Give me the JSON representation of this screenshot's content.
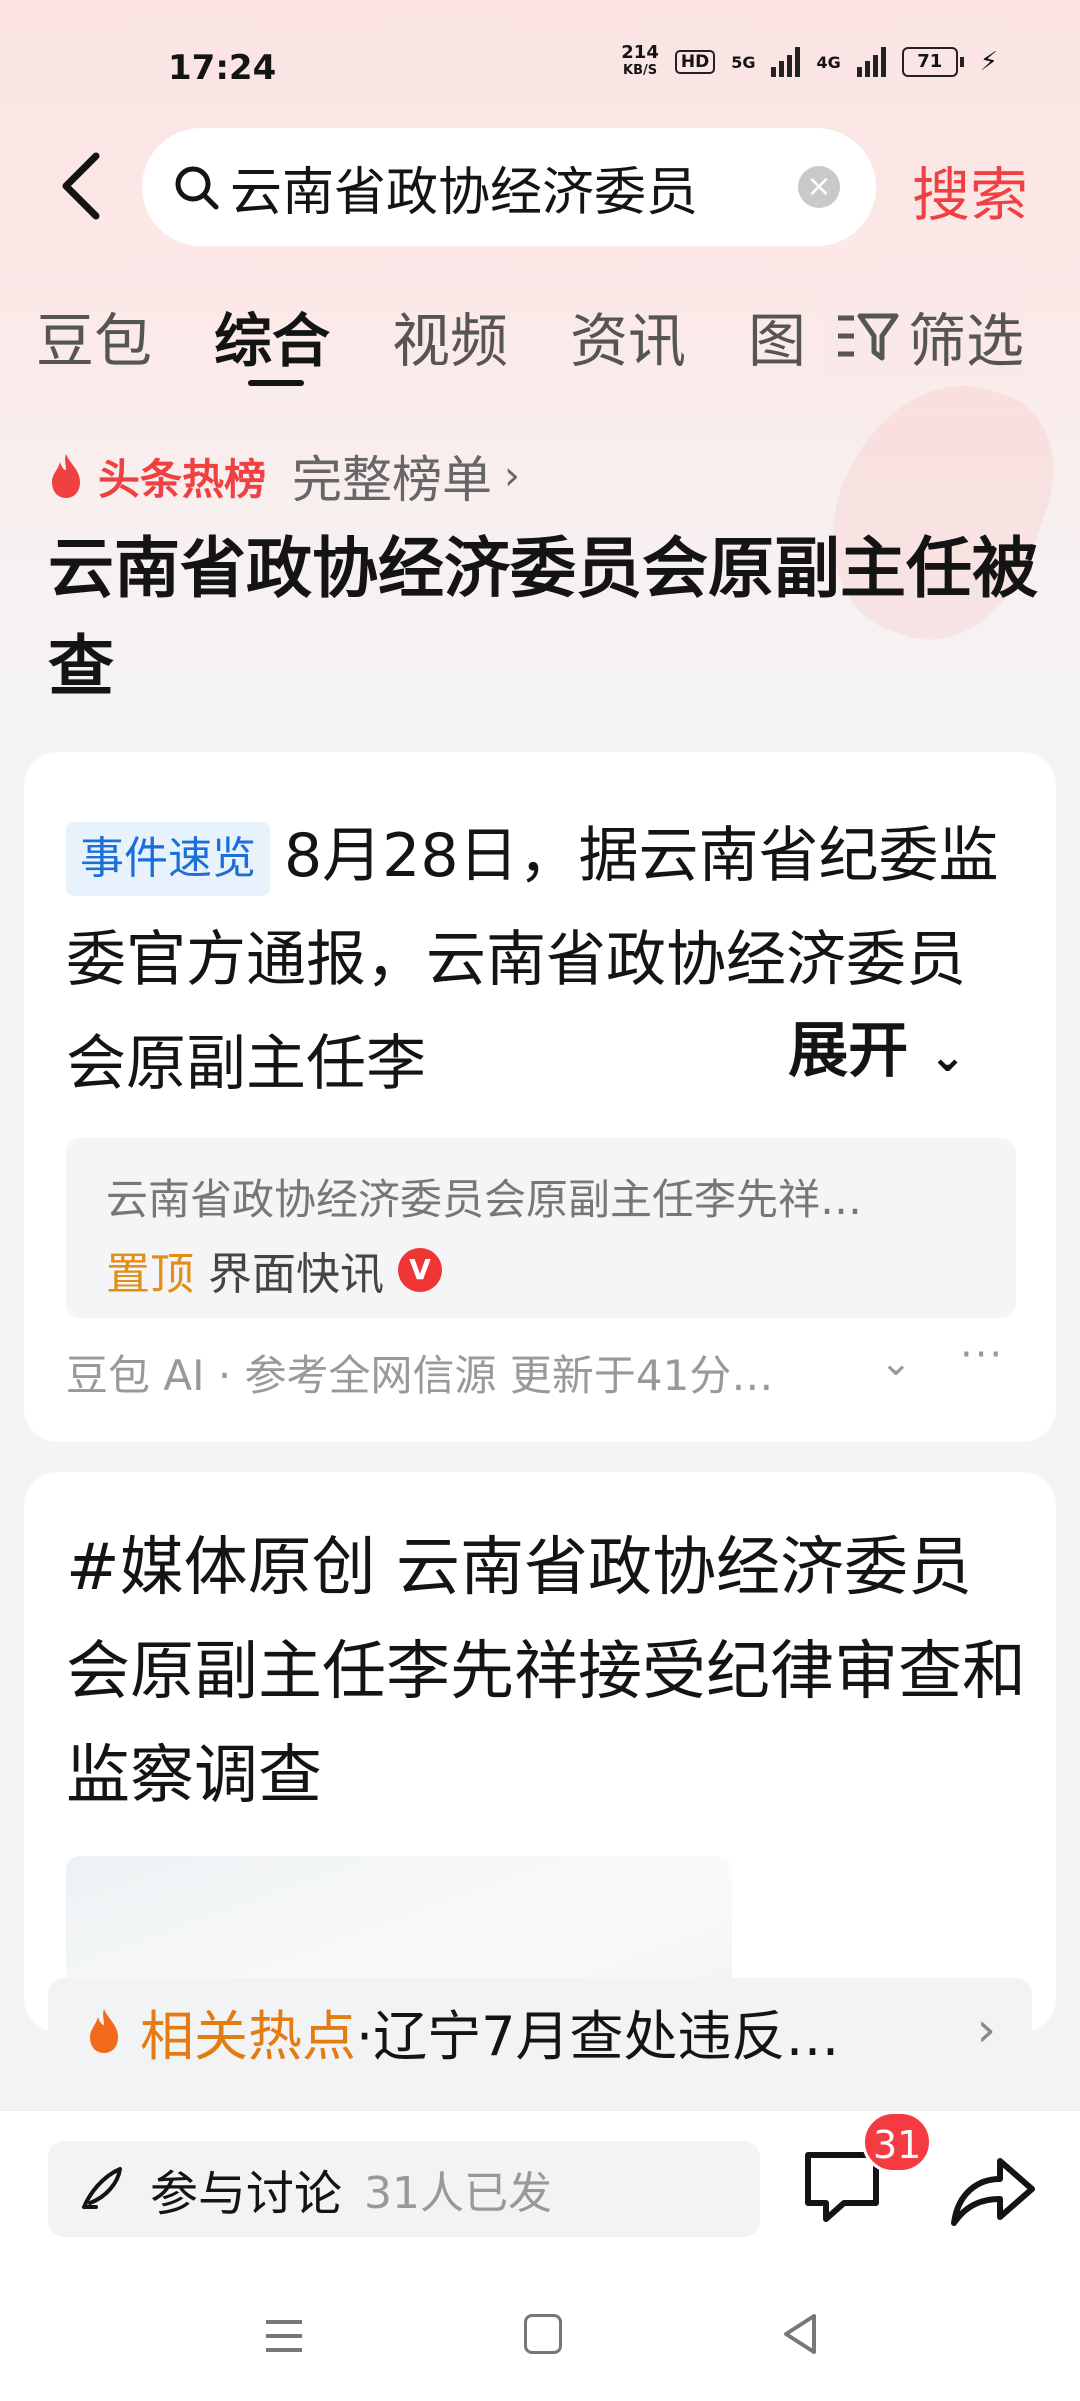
{
  "status_bar": {
    "time": "17:24",
    "net_speed_value": "214",
    "net_speed_unit": "KB/S",
    "hd": "HD",
    "net1": "5G",
    "net2": "4G",
    "battery": "71"
  },
  "search": {
    "query": "云南省政协经济委员",
    "clear_icon": "×",
    "button": "搜索"
  },
  "tabs": [
    {
      "label": "豆包"
    },
    {
      "label": "综合",
      "active": true
    },
    {
      "label": "视频"
    },
    {
      "label": "资讯"
    },
    {
      "label": "图"
    }
  ],
  "filter_label": "筛选",
  "hot": {
    "label": "头条热榜",
    "rank_link": "完整榜单",
    "chevron": "›",
    "headline": "云南省政协经济委员会原副主任被查"
  },
  "summary_card": {
    "tag": "事件速览",
    "text": "8月28日，据云南省纪委监委官方通报，云南省政协经济委员会原副主任李",
    "expand": "展开",
    "expand_icon": "⌄",
    "source_title": "云南省政协经济委员会原副主任李先祥…",
    "pin": "置顶",
    "publisher": "界面快讯",
    "verified": "V",
    "ai_footer": "豆包 AI · 参考全网信源 更新于41分…",
    "chevron": "⌄",
    "more": "···"
  },
  "article_card": {
    "title": "#媒体原创 云南省政协经济委员会原副主任李先祥接受纪律审查和监察调查"
  },
  "related": {
    "label": "相关热点",
    "text": "·辽宁7月查处违反…",
    "chevron": "›"
  },
  "bottom": {
    "discuss": "参与讨论",
    "count_text": "31人已发",
    "comment_badge": "31"
  },
  "colors": {
    "accent": "#f04142",
    "tag_blue": "#1b6fd6",
    "pin_orange": "#e08f18",
    "related_orange": "#e37c12"
  }
}
